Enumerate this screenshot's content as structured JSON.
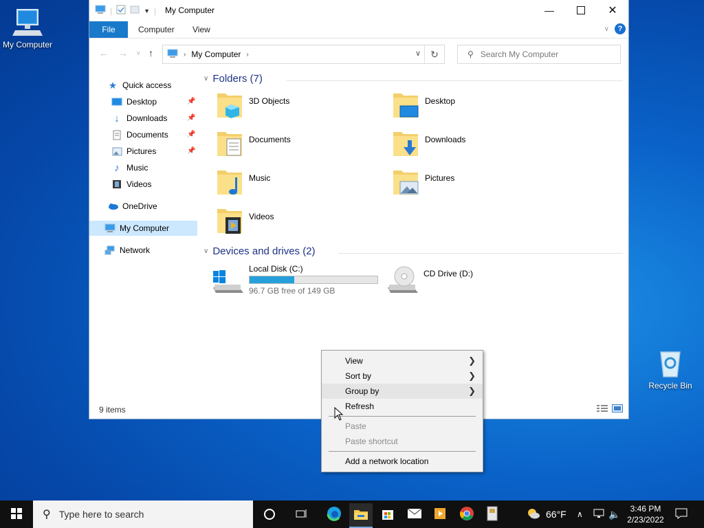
{
  "desktop": {
    "my_computer_label": "My Computer",
    "recycle_bin_label": "Recycle Bin"
  },
  "window": {
    "title": "My Computer",
    "ribbon": {
      "file": "File",
      "computer": "Computer",
      "view": "View"
    },
    "address": {
      "location": "My Computer"
    },
    "search_placeholder": "Search My Computer"
  },
  "nav": {
    "quick_access": "Quick access",
    "desktop": "Desktop",
    "downloads": "Downloads",
    "documents": "Documents",
    "pictures": "Pictures",
    "music": "Music",
    "videos": "Videos",
    "onedrive": "OneDrive",
    "my_computer": "My Computer",
    "network": "Network"
  },
  "content": {
    "folders_header": "Folders (7)",
    "folders": [
      "3D Objects",
      "Desktop",
      "Documents",
      "Downloads",
      "Music",
      "Pictures",
      "Videos"
    ],
    "devices_header": "Devices and drives (2)",
    "drive_c": {
      "name": "Local Disk (C:)",
      "free": "96.7 GB free of 149 GB",
      "used_fraction": 0.35
    },
    "drive_d": {
      "name": "CD Drive (D:)"
    }
  },
  "status": {
    "items": "9 items"
  },
  "context_menu": {
    "view": "View",
    "sort_by": "Sort by",
    "group_by": "Group by",
    "refresh": "Refresh",
    "paste": "Paste",
    "paste_shortcut": "Paste shortcut",
    "add_network_location": "Add a network location"
  },
  "taskbar": {
    "search_placeholder": "Type here to search",
    "weather": "66°F",
    "time": "3:46 PM",
    "date": "2/23/2022"
  },
  "colors": {
    "accent": "#1979ca",
    "selection": "#cce8ff",
    "drive_fill": "#26a0da"
  }
}
